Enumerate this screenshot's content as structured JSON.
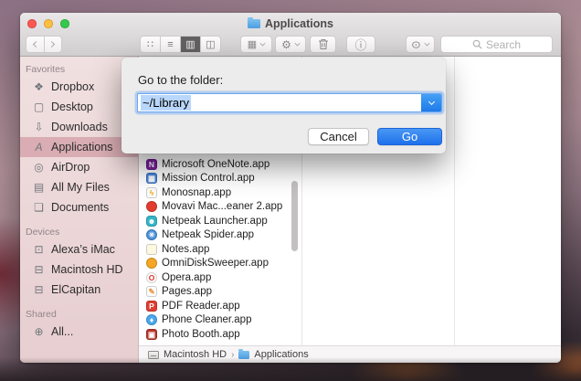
{
  "window": {
    "title": "Applications",
    "toolbar": {
      "search_placeholder": "Search",
      "icons": {
        "view_icon": "∷",
        "view_list": "≡",
        "view_column": "▥",
        "view_coverflow": "◫",
        "arrange": "▦",
        "action": "⚙",
        "eye": "⊙",
        "info": "ⓘ"
      }
    },
    "sidebar": {
      "sections": [
        {
          "header": "Favorites",
          "items": [
            {
              "label": "Dropbox",
              "icon": "❖"
            },
            {
              "label": "Desktop",
              "icon": "▢"
            },
            {
              "label": "Downloads",
              "icon": "⇩"
            },
            {
              "label": "Applications",
              "icon": "A"
            },
            {
              "label": "AirDrop",
              "icon": "◎"
            },
            {
              "label": "All My Files",
              "icon": "▤"
            },
            {
              "label": "Documents",
              "icon": "❏"
            }
          ]
        },
        {
          "header": "Devices",
          "items": [
            {
              "label": "Alexa’s iMac",
              "icon": "⊡"
            },
            {
              "label": "Macintosh HD",
              "icon": "⊟"
            },
            {
              "label": "ElCapitan",
              "icon": "⊟"
            }
          ]
        },
        {
          "header": "Shared",
          "items": [
            {
              "label": "All...",
              "icon": "⊕"
            }
          ]
        }
      ]
    },
    "files": [
      {
        "name": "Microsoft OneNote.app",
        "glyph": "N",
        "bg": "#7a1fa2",
        "fg": "#ffffff",
        "radius": "3px"
      },
      {
        "name": "Mission Control.app",
        "glyph": "▦",
        "bg": "#4a84d8",
        "fg": "#ffffff",
        "radius": "3px"
      },
      {
        "name": "Monosnap.app",
        "glyph": "ϟ",
        "bg": "#fbfbfb",
        "fg": "#f0a500",
        "radius": "3px"
      },
      {
        "name": "Movavi Mac...eaner 2.app",
        "glyph": "",
        "bg": "#e23b2e",
        "fg": "#ffffff",
        "radius": "50%"
      },
      {
        "name": "Netpeak Launcher.app",
        "glyph": "☻",
        "bg": "#35b6c9",
        "fg": "#ffffff",
        "radius": "4px"
      },
      {
        "name": "Netpeak Spider.app",
        "glyph": "✳",
        "bg": "#4a90d9",
        "fg": "#ffffff",
        "radius": "50%"
      },
      {
        "name": "Notes.app",
        "glyph": "",
        "bg": "#fdf8e2",
        "fg": "#d8c45a",
        "radius": "3px"
      },
      {
        "name": "OmniDiskSweeper.app",
        "glyph": "",
        "bg": "#f5a623",
        "fg": "#ffffff",
        "radius": "50%"
      },
      {
        "name": "Opera.app",
        "glyph": "O",
        "bg": "#ffffff",
        "fg": "#e0342b",
        "radius": "50%"
      },
      {
        "name": "Pages.app",
        "glyph": "✎",
        "bg": "#fbfbfb",
        "fg": "#e8943a",
        "radius": "3px"
      },
      {
        "name": "PDF Reader.app",
        "glyph": "P",
        "bg": "#e03c31",
        "fg": "#ffffff",
        "radius": "3px"
      },
      {
        "name": "Phone Cleaner.app",
        "glyph": "♦",
        "bg": "#49a8ef",
        "fg": "#ffffff",
        "radius": "50%"
      },
      {
        "name": "Photo Booth.app",
        "glyph": "▣",
        "bg": "#b5352c",
        "fg": "#ffffff",
        "radius": "3px"
      }
    ],
    "pathbar": {
      "disk": "Macintosh HD",
      "separator": "›",
      "folder": "Applications"
    }
  },
  "dialog": {
    "label": "Go to the folder:",
    "field_value": "~/Library",
    "cancel_label": "Cancel",
    "go_label": "Go"
  },
  "colors": {
    "selection_highlight": "#b9d7fb",
    "sidebar_selected": "#d9adb3",
    "accent_blue": "#2a80ee"
  }
}
